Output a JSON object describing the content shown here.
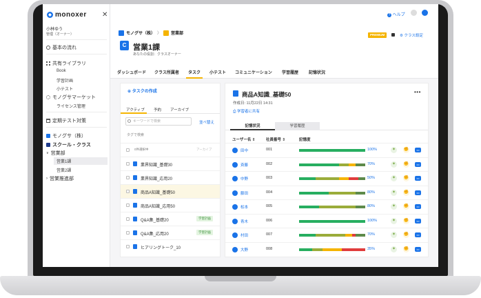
{
  "sidebar": {
    "logo": "monoxer",
    "close": "✕",
    "user_name": "小林ゆう",
    "user_role": "管理（オーナー）",
    "items": [
      {
        "label": "基本の流れ"
      },
      {
        "label": "共有ライブラリ"
      },
      {
        "label": "Book"
      },
      {
        "label": "学習計画"
      },
      {
        "label": "小テスト"
      },
      {
        "label": "モノグサマーケット"
      },
      {
        "label": "ライセンス管理"
      },
      {
        "label": "定期テスト対策"
      },
      {
        "label": "モノグサ（株）"
      },
      {
        "label": "スクール・クラス"
      },
      {
        "label": "営業部"
      },
      {
        "label": "営業1課"
      },
      {
        "label": "営業2課"
      },
      {
        "label": "営業推進部"
      }
    ]
  },
  "topbar": {
    "help": "ヘルプ"
  },
  "header": {
    "breadcrumb_org": "モノグサ（株）",
    "breadcrumb_sep": "〉",
    "breadcrumb_dept": "営業部",
    "title_icon": "C",
    "title": "営業1課",
    "subtitle": "あなたの役割：クラスオーナー",
    "premium": "PREMIUM",
    "class_settings": "クラス設定"
  },
  "tabs": [
    "ダッシュボード",
    "クラス所属者",
    "タスク",
    "小テスト",
    "コミュニケーション",
    "学習履歴",
    "記憶状況"
  ],
  "task_panel": {
    "add_task": "タスクの作成",
    "subtabs": [
      "アクティブ",
      "予約",
      "アーカイブ"
    ],
    "search_placeholder": "キーワードで検索",
    "sort": "並べ替え",
    "tag_search": "タグで検索",
    "selected_count": "0件選択中",
    "archive": "アーカイブ",
    "tasks": [
      {
        "name": "業界知識_基礎30",
        "badge": ""
      },
      {
        "name": "業界知識_応用20",
        "badge": ""
      },
      {
        "name": "商品A知識_基礎50",
        "badge": ""
      },
      {
        "name": "商品A知識_応用50",
        "badge": ""
      },
      {
        "name": "Q&A集_基礎20",
        "badge": "学習計画"
      },
      {
        "name": "Q&A集_応用20",
        "badge": "学習計画"
      },
      {
        "name": "ヒアリングトーク_10",
        "badge": ""
      }
    ]
  },
  "detail": {
    "title": "商品A知識_基礎50",
    "more": "•••",
    "date": "作成日: 11月22日 14:31",
    "share": "学習者に共有",
    "tabs": [
      "記憶状況",
      "学習履歴"
    ],
    "columns": [
      "ユーザー名 ⇕",
      "社員番号 ⇕",
      "記憶度"
    ],
    "rows": [
      {
        "name": "田中",
        "id": "001",
        "pct": "100%",
        "segments": [
          {
            "c": "#27ae60",
            "w": 1.0
          }
        ]
      },
      {
        "name": "斉藤",
        "id": "002",
        "pct": "70%",
        "segments": [
          {
            "c": "#27ae60",
            "w": 0.6
          },
          {
            "c": "#9aac3a",
            "w": 0.15
          },
          {
            "c": "#f5b400",
            "w": 0.1
          },
          {
            "c": "#5d8a4a",
            "w": 0.15
          }
        ]
      },
      {
        "name": "中野",
        "id": "003",
        "pct": "50%",
        "segments": [
          {
            "c": "#27ae60",
            "w": 0.25
          },
          {
            "c": "#9aac3a",
            "w": 0.35
          },
          {
            "c": "#f5b400",
            "w": 0.15
          },
          {
            "c": "#e03c3c",
            "w": 0.15
          },
          {
            "c": "#5d8a4a",
            "w": 0.1
          }
        ]
      },
      {
        "name": "藤田",
        "id": "004",
        "pct": "80%",
        "segments": [
          {
            "c": "#27ae60",
            "w": 0.45
          },
          {
            "c": "#9aac3a",
            "w": 0.4
          },
          {
            "c": "#5d8a4a",
            "w": 0.15
          }
        ]
      },
      {
        "name": "松本",
        "id": "005",
        "pct": "80%",
        "segments": [
          {
            "c": "#27ae60",
            "w": 0.3
          },
          {
            "c": "#9aac3a",
            "w": 0.55
          },
          {
            "c": "#5d8a4a",
            "w": 0.15
          }
        ]
      },
      {
        "name": "青木",
        "id": "006",
        "pct": "100%",
        "segments": [
          {
            "c": "#27ae60",
            "w": 1.0
          }
        ]
      },
      {
        "name": "村田",
        "id": "007",
        "pct": "70%",
        "segments": [
          {
            "c": "#27ae60",
            "w": 0.25
          },
          {
            "c": "#9aac3a",
            "w": 0.45
          },
          {
            "c": "#f5b400",
            "w": 0.1
          },
          {
            "c": "#e03c3c",
            "w": 0.05
          },
          {
            "c": "#5d8a4a",
            "w": 0.15
          }
        ]
      },
      {
        "name": "大野",
        "id": "008",
        "pct": "35%",
        "segments": [
          {
            "c": "#27ae60",
            "w": 0.2
          },
          {
            "c": "#9aac3a",
            "w": 0.15
          },
          {
            "c": "#f5b400",
            "w": 0.3
          },
          {
            "c": "#e03c3c",
            "w": 0.35
          }
        ]
      }
    ]
  },
  "colors": {
    "accent": "#1a73e8",
    "tab_underline": "#f5b400",
    "badge_bg": "#e3f4e0"
  }
}
